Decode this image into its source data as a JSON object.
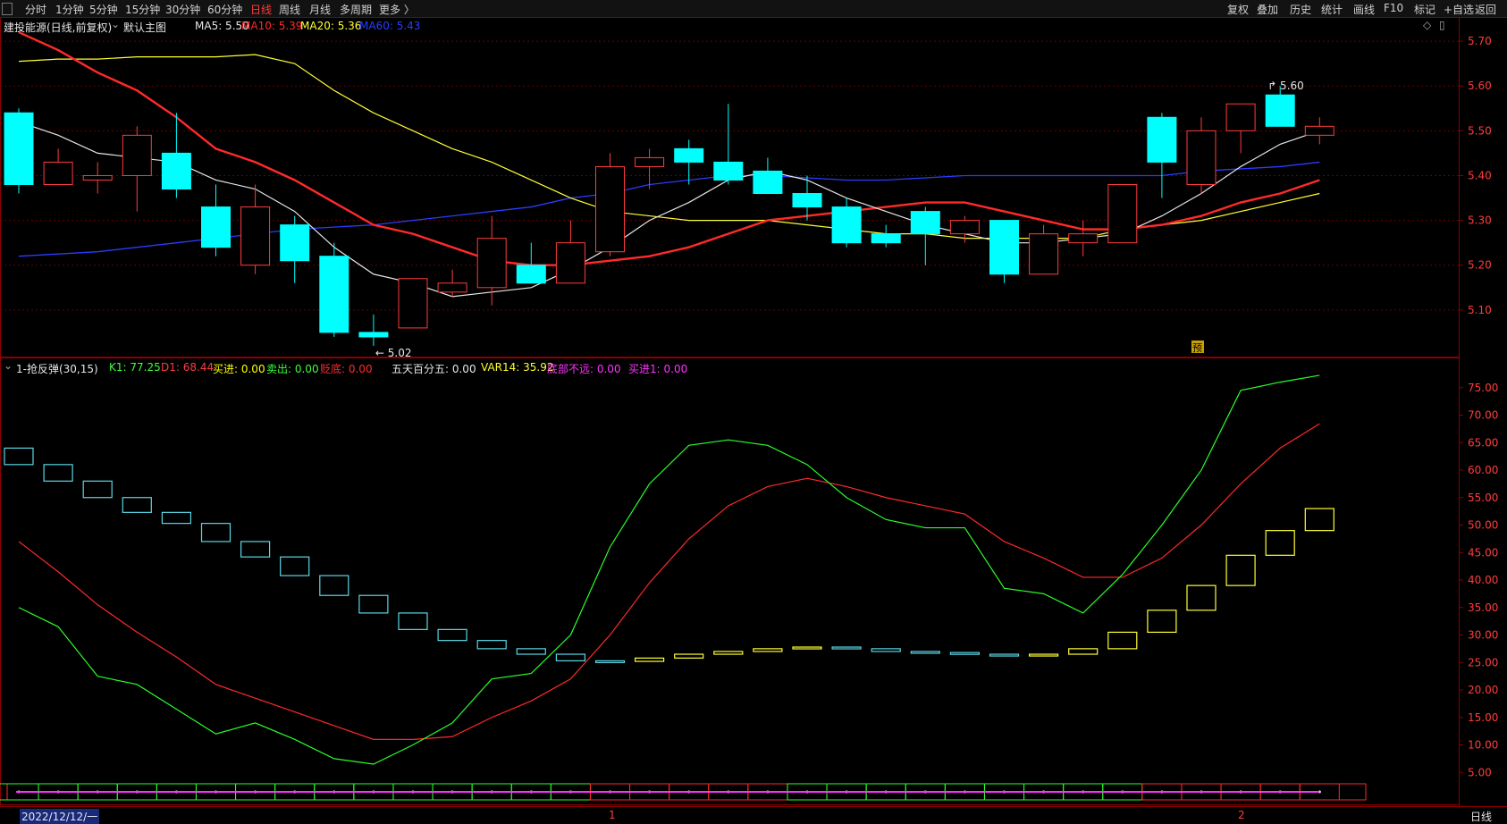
{
  "toolbar": {
    "left": [
      "分时",
      "1分钟",
      "5分钟",
      "15分钟",
      "30分钟",
      "60分钟",
      "日线",
      "周线",
      "月线",
      "多周期",
      "更多 〉"
    ],
    "active": "日线",
    "right": [
      "复权",
      "叠加",
      "历史",
      "统计",
      "画线",
      "F10",
      "标记",
      "+自选",
      "返回"
    ]
  },
  "main_legend": {
    "stock": "建投能源(日线,前复权)",
    "template": "默认主图",
    "items": [
      {
        "label": "MA5: 5.50",
        "color": "#e6e6e6"
      },
      {
        "label": "MA10: 5.39",
        "color": "#ff2a2a"
      },
      {
        "label": "MA20: 5.36",
        "color": "#ffff33"
      },
      {
        "label": "MA60: 5.43",
        "color": "#2a3cff"
      }
    ]
  },
  "sub_legend": {
    "name": "1-抢反弹(30,15)",
    "items": [
      {
        "label": "K1: 77.25",
        "color": "#3cff3c"
      },
      {
        "label": "D1: 68.44",
        "color": "#ff3c3c"
      },
      {
        "label": "买进: 0.00",
        "color": "#ffff00"
      },
      {
        "label": "卖出: 0.00",
        "color": "#3cff3c"
      },
      {
        "label": "贬底: 0.00",
        "color": "#ff2a2a"
      },
      {
        "label": "五天百分五: 0.00",
        "color": "#e6e6e6"
      },
      {
        "label": "VAR14: 35.92",
        "color": "#ffff33"
      },
      {
        "label": "底部不远: 0.00",
        "color": "#ff33ff"
      },
      {
        "label": "买进1: 0.00",
        "color": "#ff33ff"
      }
    ]
  },
  "price_axis": [
    "5.70",
    "5.60",
    "5.50",
    "5.40",
    "5.30",
    "5.20",
    "5.10"
  ],
  "indicator_axis": [
    "75.00",
    "70.00",
    "65.00",
    "60.00",
    "55.00",
    "50.00",
    "45.00",
    "40.00",
    "35.00",
    "30.00",
    "25.00",
    "20.00",
    "15.00",
    "10.00",
    "5.00"
  ],
  "annotations": {
    "high": "5.60",
    "low": "5.02",
    "pre_marker": "预"
  },
  "bottom": {
    "date": "2022/12/12/一",
    "month1": "1",
    "month2": "2",
    "period": "日线"
  },
  "chart_data": [
    {
      "type": "candlestick",
      "title": "建投能源(日线,前复权)",
      "ylim": [
        5.0,
        5.75
      ],
      "candles": [
        {
          "o": 5.54,
          "c": 5.38,
          "h": 5.55,
          "l": 5.36
        },
        {
          "o": 5.38,
          "c": 5.43,
          "h": 5.46,
          "l": 5.38
        },
        {
          "o": 5.39,
          "c": 5.4,
          "h": 5.43,
          "l": 5.36
        },
        {
          "o": 5.4,
          "c": 5.49,
          "h": 5.51,
          "l": 5.32
        },
        {
          "o": 5.45,
          "c": 5.37,
          "h": 5.54,
          "l": 5.35
        },
        {
          "o": 5.33,
          "c": 5.24,
          "h": 5.38,
          "l": 5.22
        },
        {
          "o": 5.2,
          "c": 5.33,
          "h": 5.38,
          "l": 5.18
        },
        {
          "o": 5.29,
          "c": 5.21,
          "h": 5.31,
          "l": 5.16
        },
        {
          "o": 5.22,
          "c": 5.05,
          "h": 5.25,
          "l": 5.04
        },
        {
          "o": 5.05,
          "c": 5.04,
          "h": 5.09,
          "l": 5.02
        },
        {
          "o": 5.06,
          "c": 5.17,
          "h": 5.17,
          "l": 5.06
        },
        {
          "o": 5.14,
          "c": 5.16,
          "h": 5.19,
          "l": 5.13
        },
        {
          "o": 5.15,
          "c": 5.26,
          "h": 5.31,
          "l": 5.11
        },
        {
          "o": 5.2,
          "c": 5.16,
          "h": 5.25,
          "l": 5.16
        },
        {
          "o": 5.16,
          "c": 5.25,
          "h": 5.3,
          "l": 5.16
        },
        {
          "o": 5.23,
          "c": 5.42,
          "h": 5.45,
          "l": 5.22
        },
        {
          "o": 5.42,
          "c": 5.44,
          "h": 5.46,
          "l": 5.37
        },
        {
          "o": 5.46,
          "c": 5.43,
          "h": 5.48,
          "l": 5.38
        },
        {
          "o": 5.43,
          "c": 5.39,
          "h": 5.56,
          "l": 5.38
        },
        {
          "o": 5.41,
          "c": 5.36,
          "h": 5.44,
          "l": 5.36
        },
        {
          "o": 5.36,
          "c": 5.33,
          "h": 5.4,
          "l": 5.3
        },
        {
          "o": 5.33,
          "c": 5.25,
          "h": 5.35,
          "l": 5.24
        },
        {
          "o": 5.27,
          "c": 5.25,
          "h": 5.29,
          "l": 5.24
        },
        {
          "o": 5.32,
          "c": 5.27,
          "h": 5.33,
          "l": 5.2
        },
        {
          "o": 5.27,
          "c": 5.3,
          "h": 5.31,
          "l": 5.25
        },
        {
          "o": 5.3,
          "c": 5.18,
          "h": 5.3,
          "l": 5.16
        },
        {
          "o": 5.18,
          "c": 5.27,
          "h": 5.29,
          "l": 5.18
        },
        {
          "o": 5.25,
          "c": 5.27,
          "h": 5.3,
          "l": 5.22
        },
        {
          "o": 5.25,
          "c": 5.38,
          "h": 5.38,
          "l": 5.25
        },
        {
          "o": 5.53,
          "c": 5.43,
          "h": 5.54,
          "l": 5.35
        },
        {
          "o": 5.38,
          "c": 5.5,
          "h": 5.53,
          "l": 5.36
        },
        {
          "o": 5.5,
          "c": 5.56,
          "h": 5.56,
          "l": 5.45
        },
        {
          "o": 5.58,
          "c": 5.51,
          "h": 5.6,
          "l": 5.51
        },
        {
          "o": 5.49,
          "c": 5.51,
          "h": 5.53,
          "l": 5.47
        }
      ],
      "ma5": [
        5.52,
        5.49,
        5.45,
        5.44,
        5.43,
        5.39,
        5.37,
        5.32,
        5.24,
        5.18,
        5.16,
        5.13,
        5.14,
        5.15,
        5.19,
        5.24,
        5.3,
        5.34,
        5.39,
        5.41,
        5.39,
        5.35,
        5.32,
        5.29,
        5.27,
        5.25,
        5.25,
        5.26,
        5.27,
        5.31,
        5.36,
        5.42,
        5.47,
        5.5
      ],
      "ma10": [
        5.72,
        5.68,
        5.63,
        5.59,
        5.53,
        5.46,
        5.43,
        5.39,
        5.34,
        5.29,
        5.27,
        5.24,
        5.21,
        5.2,
        5.2,
        5.21,
        5.22,
        5.24,
        5.27,
        5.3,
        5.31,
        5.32,
        5.33,
        5.34,
        5.34,
        5.32,
        5.3,
        5.28,
        5.28,
        5.29,
        5.31,
        5.34,
        5.36,
        5.39
      ],
      "ma20": [
        5.655,
        5.66,
        5.66,
        5.665,
        5.665,
        5.665,
        5.67,
        5.65,
        5.59,
        5.54,
        5.5,
        5.46,
        5.43,
        5.39,
        5.35,
        5.32,
        5.31,
        5.3,
        5.3,
        5.3,
        5.29,
        5.28,
        5.27,
        5.27,
        5.26,
        5.26,
        5.26,
        5.26,
        5.28,
        5.29,
        5.3,
        5.32,
        5.34,
        5.36
      ],
      "ma60": [
        5.22,
        5.225,
        5.23,
        5.24,
        5.25,
        5.26,
        5.27,
        5.28,
        5.285,
        5.29,
        5.3,
        5.31,
        5.32,
        5.33,
        5.35,
        5.36,
        5.38,
        5.39,
        5.4,
        5.4,
        5.395,
        5.39,
        5.39,
        5.395,
        5.4,
        5.4,
        5.4,
        5.4,
        5.4,
        5.4,
        5.41,
        5.415,
        5.42,
        5.43
      ]
    },
    {
      "type": "line",
      "title": "1-抢反弹(30,15)",
      "ylim": [
        0,
        80
      ],
      "series": [
        {
          "name": "K1",
          "values": [
            35,
            31.5,
            22.5,
            21,
            16.5,
            12,
            14,
            11,
            7.5,
            6.5,
            10,
            14,
            22,
            23,
            30,
            46,
            57.5,
            64.5,
            65.5,
            64.5,
            61,
            55,
            51,
            49.5,
            49.5,
            38.5,
            37.5,
            34,
            41,
            50,
            60,
            74.5,
            76,
            77.25
          ]
        },
        {
          "name": "D1",
          "values": [
            47,
            41.5,
            35.5,
            30.5,
            26,
            21,
            18.5,
            16,
            13.5,
            11,
            11,
            11.5,
            15,
            18,
            22,
            30,
            39.5,
            47.5,
            53.5,
            57,
            58.5,
            57,
            55,
            53.5,
            52,
            47,
            44,
            40.5,
            40.5,
            44,
            50,
            57.5,
            64,
            68.44
          ]
        },
        {
          "name": "VAR14",
          "values": [
            61,
            58,
            55,
            52.3,
            50.3,
            47,
            44.2,
            40.8,
            37.2,
            34,
            31,
            29,
            27.5,
            26.5,
            25.3,
            25.2,
            25.8,
            26.5,
            27,
            27.5,
            27.8,
            27.5,
            27,
            26.8,
            26.5,
            26.3,
            26.5,
            27.5,
            30.5,
            34.5,
            39,
            44.5,
            49,
            53
          ]
        }
      ]
    }
  ]
}
